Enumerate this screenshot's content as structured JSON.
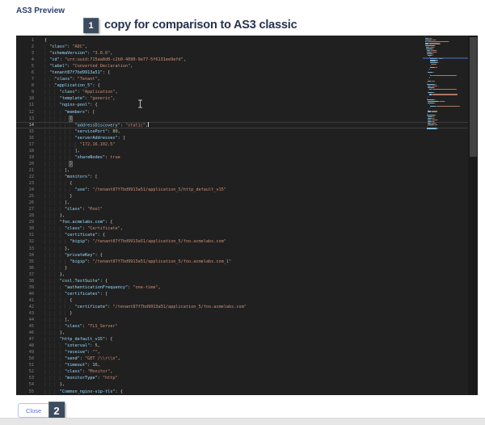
{
  "header": {
    "title": "AS3 Preview"
  },
  "annotations": {
    "marker1": {
      "number": "1",
      "label": "copy for comparison to AS3 classic"
    },
    "marker2": {
      "number": "2"
    }
  },
  "footer": {
    "close_label": "Close"
  },
  "theme": {
    "editor_bg": "#202020",
    "key": "#9cdcfe",
    "string": "#ce9178",
    "number": "#b5cea8",
    "boolean": "#ce9178",
    "punct": "#d4d4d4",
    "line_num": "#858585",
    "active_line_num": "#c6c6c6",
    "guide": "#3a3a3a",
    "cur_line_border": "#3c3c3c",
    "caret": "#d8d8d8",
    "scroll_thumb": "#424242",
    "mm_highlight": "rgba(86,128,219,0.45)",
    "title": "#2d3e6e",
    "annot_text": "#26324e",
    "badge_bg": "#3d4b5f",
    "close_text": "#5b74d6",
    "close_border": "#b9c3e8",
    "band_bg": "#e6e6e6"
  },
  "editor": {
    "current_line": 14,
    "lines": [
      {
        "t": [
          [
            "p",
            "{"
          ]
        ]
      },
      {
        "t": [
          [
            "p",
            "  "
          ],
          [
            "k",
            "\"class\""
          ],
          [
            "p",
            ": "
          ],
          [
            "s",
            "\"ADC\""
          ],
          [
            "p",
            ","
          ]
        ]
      },
      {
        "t": [
          [
            "p",
            "  "
          ],
          [
            "k",
            "\"schemaVersion\""
          ],
          [
            "p",
            ": "
          ],
          [
            "s",
            "\"3.0.0\""
          ],
          [
            "p",
            ","
          ]
        ]
      },
      {
        "t": [
          [
            "p",
            "  "
          ],
          [
            "k",
            "\"id\""
          ],
          [
            "p",
            ": "
          ],
          [
            "s",
            "\"urn:uuid:715aa8d8-c2b0-4890-9e77-5f6131ee9efd\""
          ],
          [
            "p",
            ","
          ]
        ]
      },
      {
        "t": [
          [
            "p",
            "  "
          ],
          [
            "k",
            "\"label\""
          ],
          [
            "p",
            ": "
          ],
          [
            "s",
            "\"Converted Declaration\""
          ],
          [
            "p",
            ","
          ]
        ]
      },
      {
        "t": [
          [
            "p",
            "  "
          ],
          [
            "k",
            "\"tenant87f7bd9913a51\""
          ],
          [
            "p",
            ": {"
          ]
        ]
      },
      {
        "t": [
          [
            "p",
            "    "
          ],
          [
            "k",
            "\"class\""
          ],
          [
            "p",
            ": "
          ],
          [
            "s",
            "\"Tenant\""
          ],
          [
            "p",
            ","
          ]
        ]
      },
      {
        "t": [
          [
            "p",
            "    "
          ],
          [
            "k",
            "\"application_5\""
          ],
          [
            "p",
            ": {"
          ]
        ]
      },
      {
        "t": [
          [
            "p",
            "      "
          ],
          [
            "k",
            "\"class\""
          ],
          [
            "p",
            ": "
          ],
          [
            "s",
            "\"Application\""
          ],
          [
            "p",
            ","
          ]
        ]
      },
      {
        "t": [
          [
            "p",
            "      "
          ],
          [
            "k",
            "\"template\""
          ],
          [
            "p",
            ": "
          ],
          [
            "s",
            "\"generic\""
          ],
          [
            "p",
            ","
          ]
        ]
      },
      {
        "t": [
          [
            "p",
            "      "
          ],
          [
            "k",
            "\"nginx-pool\""
          ],
          [
            "p",
            ": {"
          ]
        ]
      },
      {
        "t": [
          [
            "p",
            "        "
          ],
          [
            "k",
            "\"members\""
          ],
          [
            "p",
            ": ["
          ]
        ]
      },
      {
        "t": [
          [
            "p",
            "          "
          ],
          [
            "m",
            "{"
          ]
        ]
      },
      {
        "t": [
          [
            "p",
            "            "
          ],
          [
            "k",
            "\"addressDiscovery\""
          ],
          [
            "p",
            ": "
          ],
          [
            "s",
            "\"static\""
          ],
          [
            "p",
            ","
          ]
        ],
        "cur": true,
        "caret": true
      },
      {
        "t": [
          [
            "p",
            "            "
          ],
          [
            "k",
            "\"servicePort\""
          ],
          [
            "p",
            ": "
          ],
          [
            "n",
            "80"
          ],
          [
            "p",
            ","
          ]
        ]
      },
      {
        "t": [
          [
            "p",
            "            "
          ],
          [
            "k",
            "\"serverAddresses\""
          ],
          [
            "p",
            ": ["
          ]
        ]
      },
      {
        "t": [
          [
            "p",
            "              "
          ],
          [
            "s",
            "\"172.16.102.5\""
          ]
        ]
      },
      {
        "t": [
          [
            "p",
            "            ],"
          ]
        ]
      },
      {
        "t": [
          [
            "p",
            "            "
          ],
          [
            "k",
            "\"shareNodes\""
          ],
          [
            "p",
            ": "
          ],
          [
            "b",
            "true"
          ]
        ]
      },
      {
        "t": [
          [
            "p",
            "          "
          ],
          [
            "m",
            "}"
          ]
        ]
      },
      {
        "t": [
          [
            "p",
            "        ],"
          ]
        ]
      },
      {
        "t": [
          [
            "p",
            "        "
          ],
          [
            "k",
            "\"monitors\""
          ],
          [
            "p",
            ": ["
          ]
        ]
      },
      {
        "t": [
          [
            "p",
            "          {"
          ]
        ]
      },
      {
        "t": [
          [
            "p",
            "            "
          ],
          [
            "k",
            "\"use\""
          ],
          [
            "p",
            ": "
          ],
          [
            "s",
            "\"/tenant87f7bd9913a51/application_5/http_default_v15\""
          ]
        ]
      },
      {
        "t": [
          [
            "p",
            "          }"
          ]
        ]
      },
      {
        "t": [
          [
            "p",
            "        ],"
          ]
        ]
      },
      {
        "t": [
          [
            "p",
            "        "
          ],
          [
            "k",
            "\"class\""
          ],
          [
            "p",
            ": "
          ],
          [
            "s",
            "\"Pool\""
          ]
        ]
      },
      {
        "t": [
          [
            "p",
            "      },"
          ]
        ]
      },
      {
        "t": [
          [
            "p",
            "      "
          ],
          [
            "k",
            "\"foo.acmelabs.com\""
          ],
          [
            "p",
            ": {"
          ]
        ]
      },
      {
        "t": [
          [
            "p",
            "        "
          ],
          [
            "k",
            "\"class\""
          ],
          [
            "p",
            ": "
          ],
          [
            "s",
            "\"Certificate\""
          ],
          [
            "p",
            ","
          ]
        ]
      },
      {
        "t": [
          [
            "p",
            "        "
          ],
          [
            "k",
            "\"certificate\""
          ],
          [
            "p",
            ": {"
          ]
        ]
      },
      {
        "t": [
          [
            "p",
            "          "
          ],
          [
            "k",
            "\"bigip\""
          ],
          [
            "p",
            ": "
          ],
          [
            "s",
            "\"/tenant87f7bd9913a51/application_5/foo.acmelabs.com\""
          ]
        ]
      },
      {
        "t": [
          [
            "p",
            "        },"
          ]
        ]
      },
      {
        "t": [
          [
            "p",
            "        "
          ],
          [
            "k",
            "\"privateKey\""
          ],
          [
            "p",
            ": {"
          ]
        ]
      },
      {
        "t": [
          [
            "p",
            "          "
          ],
          [
            "k",
            "\"bigip\""
          ],
          [
            "p",
            ": "
          ],
          [
            "s",
            "\"/tenant87f7bd9913a51/application_5/foo.acmelabs.com_1\""
          ]
        ]
      },
      {
        "t": [
          [
            "p",
            "        }"
          ]
        ]
      },
      {
        "t": [
          [
            "p",
            "      },"
          ]
        ]
      },
      {
        "t": [
          [
            "p",
            "      "
          ],
          [
            "k",
            "\"cssl.TestSuite\""
          ],
          [
            "p",
            ": {"
          ]
        ]
      },
      {
        "t": [
          [
            "p",
            "        "
          ],
          [
            "k",
            "\"authenticationFrequency\""
          ],
          [
            "p",
            ": "
          ],
          [
            "s",
            "\"one-time\""
          ],
          [
            "p",
            ","
          ]
        ]
      },
      {
        "t": [
          [
            "p",
            "        "
          ],
          [
            "k",
            "\"certificates\""
          ],
          [
            "p",
            ": ["
          ]
        ]
      },
      {
        "t": [
          [
            "p",
            "          {"
          ]
        ]
      },
      {
        "t": [
          [
            "p",
            "            "
          ],
          [
            "k",
            "\"certificate\""
          ],
          [
            "p",
            ": "
          ],
          [
            "s",
            "\"/tenant87f7bd9913a51/application_5/foo.acmelabs.com\""
          ]
        ]
      },
      {
        "t": [
          [
            "p",
            "          }"
          ]
        ]
      },
      {
        "t": [
          [
            "p",
            "        ],"
          ]
        ]
      },
      {
        "t": [
          [
            "p",
            "        "
          ],
          [
            "k",
            "\"class\""
          ],
          [
            "p",
            ": "
          ],
          [
            "s",
            "\"TLS_Server\""
          ]
        ]
      },
      {
        "t": [
          [
            "p",
            "      },"
          ]
        ]
      },
      {
        "t": [
          [
            "p",
            "      "
          ],
          [
            "k",
            "\"http_default_v15\""
          ],
          [
            "p",
            ": {"
          ]
        ]
      },
      {
        "t": [
          [
            "p",
            "        "
          ],
          [
            "k",
            "\"interval\""
          ],
          [
            "p",
            ": "
          ],
          [
            "n",
            "5"
          ],
          [
            "p",
            ","
          ]
        ]
      },
      {
        "t": [
          [
            "p",
            "        "
          ],
          [
            "k",
            "\"receive\""
          ],
          [
            "p",
            ": "
          ],
          [
            "s",
            "\"\""
          ],
          [
            "p",
            ","
          ]
        ]
      },
      {
        "t": [
          [
            "p",
            "        "
          ],
          [
            "k",
            "\"send\""
          ],
          [
            "p",
            ": "
          ],
          [
            "s",
            "\"GET /\\\\r\\\\n\""
          ],
          [
            "p",
            ","
          ]
        ]
      },
      {
        "t": [
          [
            "p",
            "        "
          ],
          [
            "k",
            "\"timeout\""
          ],
          [
            "p",
            ": "
          ],
          [
            "n",
            "16"
          ],
          [
            "p",
            ","
          ]
        ]
      },
      {
        "t": [
          [
            "p",
            "        "
          ],
          [
            "k",
            "\"class\""
          ],
          [
            "p",
            ": "
          ],
          [
            "s",
            "\"Monitor\""
          ],
          [
            "p",
            ","
          ]
        ]
      },
      {
        "t": [
          [
            "p",
            "        "
          ],
          [
            "k",
            "\"monitorType\""
          ],
          [
            "p",
            ": "
          ],
          [
            "s",
            "\"http\""
          ]
        ]
      },
      {
        "t": [
          [
            "p",
            "      },"
          ]
        ]
      },
      {
        "t": [
          [
            "p",
            "      "
          ],
          [
            "k",
            "\"Common_nginx-vip-tls\""
          ],
          [
            "p",
            ": {"
          ]
        ]
      }
    ]
  }
}
